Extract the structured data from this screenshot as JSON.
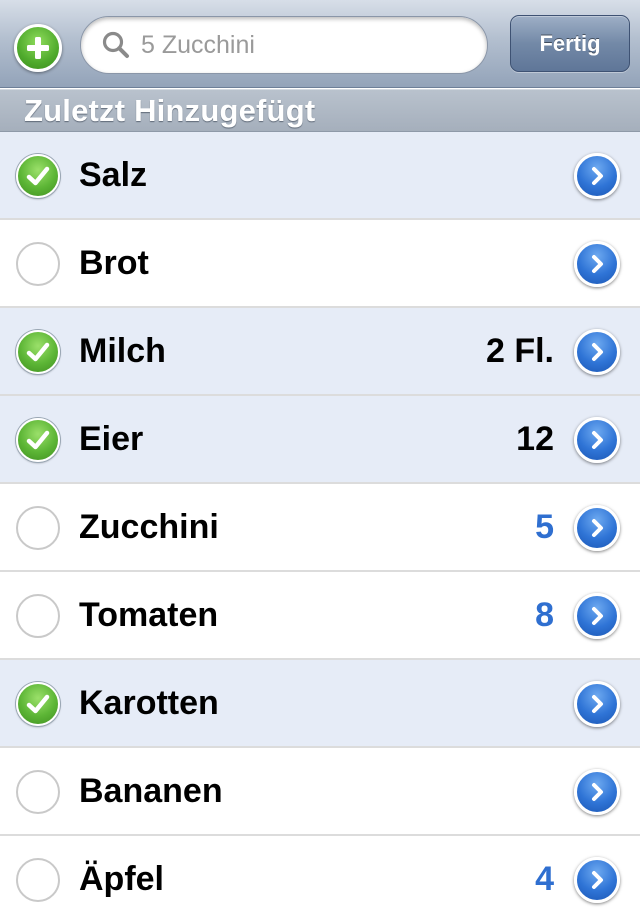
{
  "search": {
    "placeholder": "5 Zucchini",
    "value": ""
  },
  "toolbar": {
    "done_label": "Fertig",
    "add_icon": "plus-circle-icon"
  },
  "section": {
    "title": "Zuletzt Hinzugefügt"
  },
  "colors": {
    "checked_row_bg": "#e6ecf7",
    "quantity_blue": "#2f6fd0",
    "check_green": "#5cb535",
    "disclosure_blue": "#2f74d6"
  },
  "items": [
    {
      "name": "Salz",
      "quantity": "",
      "checked": true,
      "quantity_color": "black"
    },
    {
      "name": "Brot",
      "quantity": "",
      "checked": false,
      "quantity_color": "black"
    },
    {
      "name": "Milch",
      "quantity": "2 Fl.",
      "checked": true,
      "quantity_color": "black"
    },
    {
      "name": "Eier",
      "quantity": "12",
      "checked": true,
      "quantity_color": "black"
    },
    {
      "name": "Zucchini",
      "quantity": "5",
      "checked": false,
      "quantity_color": "blue"
    },
    {
      "name": "Tomaten",
      "quantity": "8",
      "checked": false,
      "quantity_color": "blue"
    },
    {
      "name": "Karotten",
      "quantity": "",
      "checked": true,
      "quantity_color": "black"
    },
    {
      "name": "Bananen",
      "quantity": "",
      "checked": false,
      "quantity_color": "black"
    },
    {
      "name": "Äpfel",
      "quantity": "4",
      "checked": false,
      "quantity_color": "blue"
    }
  ]
}
